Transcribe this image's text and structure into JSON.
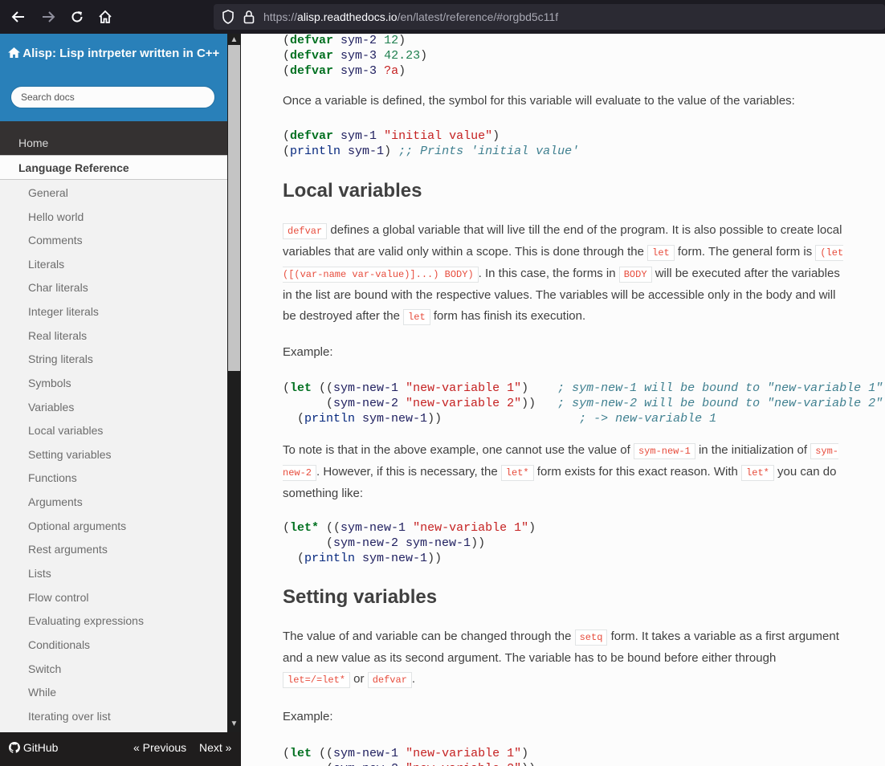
{
  "browser": {
    "url_prefix": "https://",
    "url_host": "alisp.readthedocs.io",
    "url_path": "/en/latest/reference/#orgbd5c11f"
  },
  "sidebar": {
    "project_title": "Alisp: Lisp intrpeter written in C++",
    "search_placeholder": "Search docs",
    "home": "Home",
    "current_section": "Language Reference",
    "subsections": [
      "General",
      "Hello world",
      "Comments",
      "Literals",
      "Char literals",
      "Integer literals",
      "Real literals",
      "String literals",
      "Symbols",
      "Variables",
      "Local variables",
      "Setting variables",
      "Functions",
      "Arguments",
      "Optional arguments",
      "Rest arguments",
      "Lists",
      "Flow control",
      "Evaluating expressions",
      "Conditionals",
      "Switch",
      "While",
      "Iterating over list"
    ]
  },
  "footer": {
    "github": "GitHub",
    "previous": "« Previous",
    "next": "Next »"
  },
  "content": {
    "p_defined": "Once a variable is defined, the symbol for this variable will evaluate to the value of the variables:",
    "h_local": "Local variables",
    "p_local": {
      "t1": " defines a global variable that will live till the end of the program. It is also possible to create local variables that are valid only within a scope. This is done through the ",
      "t2": " form. The general form is ",
      "t3": ". In this case, the forms in ",
      "t4": " will be executed after the variables in the list are bound with the respective values. The variables will be accessible only in the body and will be destroyed after the ",
      "t5": " form has finish its execution."
    },
    "example_label": "Example:",
    "p_note": {
      "t1": "To note is that in the above example, one cannot use the value of ",
      "t2": " in the initialization of ",
      "t3": ". However, if this is necessary, the ",
      "t4": " form exists for this exact reason. With ",
      "t5": " you can do something like:"
    },
    "h_setting": "Setting variables",
    "p_setting": {
      "t1": "The value of and variable can be changed through the ",
      "t2": " form. It takes a variable as a first argument and a new value as its second argument. The variable has to be bound before either through ",
      "t3": " or ",
      "t4": "."
    },
    "literals": {
      "defvar": "defvar",
      "let": "let",
      "let_form": "(let ([(var-name var-value)]...) BODY)",
      "body": "BODY",
      "sym_new_1": "sym-new-1",
      "sym_new_2": "sym-new-2",
      "let_star": "let*",
      "setq": "setq",
      "let_eq": "let=/=let*"
    },
    "code_tokens": {
      "defvar": "defvar",
      "let": "let",
      "let_star": "let*",
      "println": "println",
      "sym_1": "sym-1",
      "sym_2": "sym-2",
      "sym_3": "sym-3",
      "sym_new_1": "sym-new-1",
      "sym_new_2": "sym-new-2",
      "n12": "12",
      "n4223": "42.23",
      "char_a": "?a",
      "s_initial": "\"initial value\"",
      "s_newvar1": "\"new-variable 1\"",
      "s_newvar2": "\"new-variable 2\"",
      "c_prints": ";; Prints 'initial value'",
      "c_bound1": "; sym-new-1 will be bound to \"new-variable 1\"",
      "c_bound2": "; sym-new-2 will be bound to \"new-variable 2\"",
      "c_arrow": "; -> new-variable 1"
    }
  }
}
